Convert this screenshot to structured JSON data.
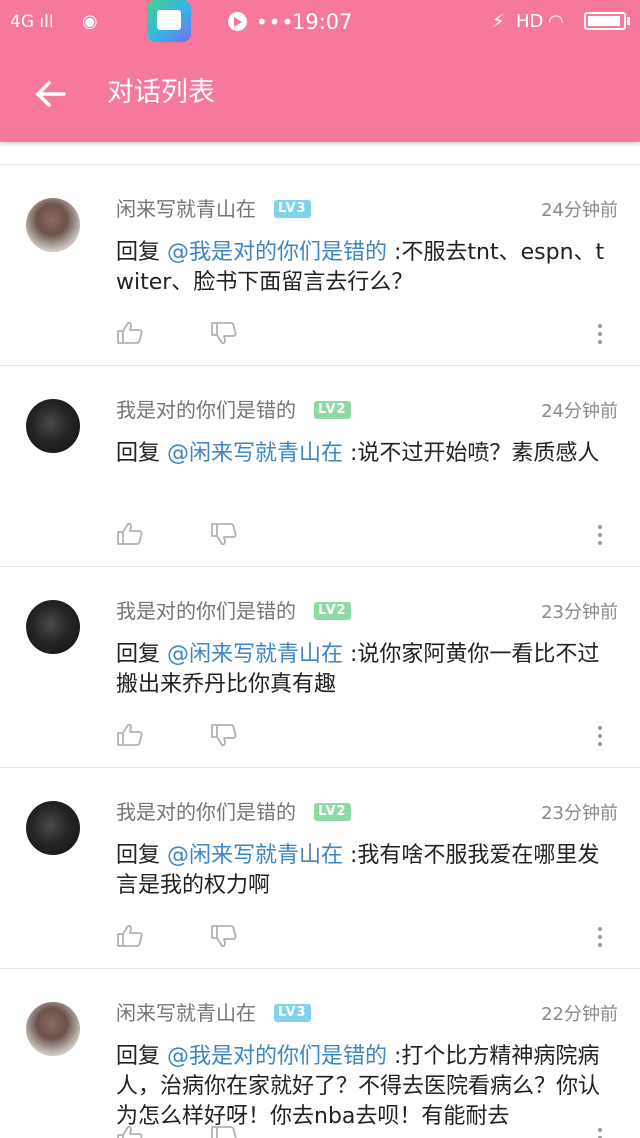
{
  "status_bar": {
    "signal_text": "4G",
    "time": "19:07",
    "more_text": "•••",
    "network_label": "HD",
    "battery_level": 0.95,
    "icons": [
      "signal-icon",
      "weibo-icon",
      "app-icon",
      "media-icon",
      "charge-icon",
      "wifi-icon",
      "battery-icon"
    ]
  },
  "toolbar": {
    "title": "对话列表",
    "back_icon": "arrow-left-icon",
    "background_color": "#f6799a"
  },
  "colors": {
    "mention": "#3d86c6",
    "level_lv3": "#7fd3ea",
    "level_lv2": "#8fd9a7"
  },
  "comments": [
    {
      "username": "闲来写就青山在",
      "level": "LV3",
      "time": "24分钟前",
      "reply_prefix": "回复 ",
      "mention": "@我是对的你们是错的",
      "text": " :不服去tnt、espn、twiter、脸书下面留言去行么？"
    },
    {
      "username": "我是对的你们是错的",
      "level": "LV2",
      "time": "24分钟前",
      "reply_prefix": "回复 ",
      "mention": "@闲来写就青山在",
      "text": " :说不过开始喷？素质感人"
    },
    {
      "username": "我是对的你们是错的",
      "level": "LV2",
      "time": "23分钟前",
      "reply_prefix": "回复 ",
      "mention": "@闲来写就青山在",
      "text": " :说你家阿黄你一看比不过搬出来乔丹比你真有趣"
    },
    {
      "username": "我是对的你们是错的",
      "level": "LV2",
      "time": "23分钟前",
      "reply_prefix": "回复 ",
      "mention": "@闲来写就青山在",
      "text": " :我有啥不服我爱在哪里发言是我的权力啊"
    },
    {
      "username": "闲来写就青山在",
      "level": "LV3",
      "time": "22分钟前",
      "reply_prefix": "回复 ",
      "mention": "@我是对的你们是错的",
      "text": " :打个比方精神病院病人，治病你在家就好了？不得去医院看病么？你认为怎么样好呀！你去nba去呗！有能耐去"
    }
  ]
}
